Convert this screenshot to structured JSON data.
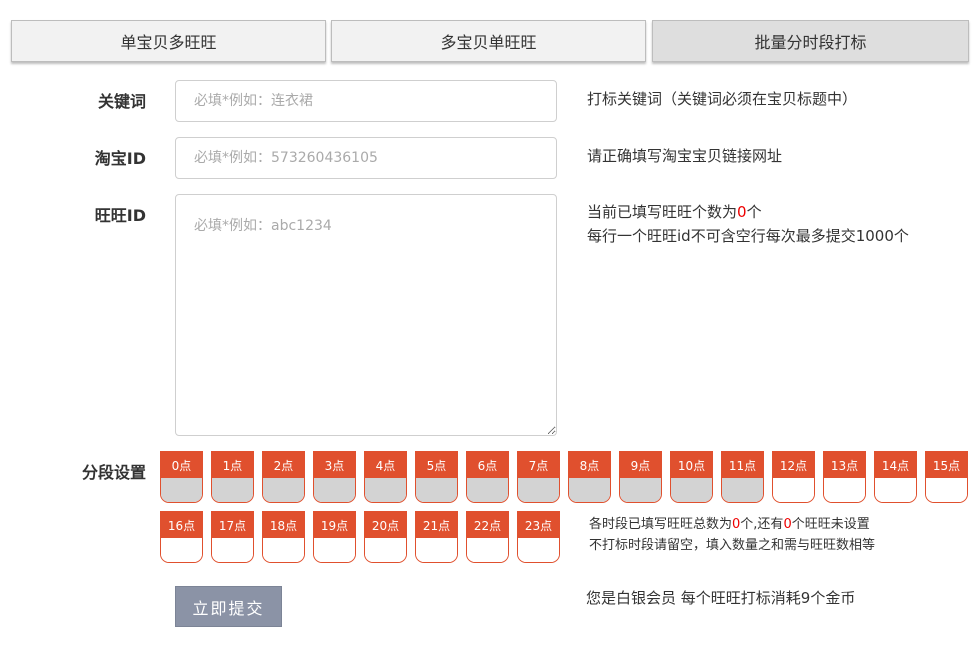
{
  "tabs": [
    {
      "label": "单宝贝多旺旺",
      "active": false
    },
    {
      "label": "多宝贝单旺旺",
      "active": false
    },
    {
      "label": "批量分时段打标",
      "active": true
    }
  ],
  "form": {
    "keyword": {
      "label": "关键词",
      "placeholder": "必填*例如：连衣裙",
      "value": "",
      "hint": "打标关键词（关键词必须在宝贝标题中）"
    },
    "taobao_id": {
      "label": "淘宝ID",
      "placeholder": "必填*例如：573260436105",
      "value": "",
      "hint": "请正确填写淘宝宝贝链接网址"
    },
    "wangwang_id": {
      "label": "旺旺ID",
      "placeholder": "必填*例如：abc1234",
      "value": "",
      "count_prefix": "当前已填写旺旺个数为",
      "count": "0",
      "count_suffix": "个",
      "hint2": "每行一个旺旺id不可含空行每次最多提交1000个"
    }
  },
  "segments": {
    "label": "分段设置",
    "hours": [
      {
        "label": "0点",
        "filled": true
      },
      {
        "label": "1点",
        "filled": true
      },
      {
        "label": "2点",
        "filled": true
      },
      {
        "label": "3点",
        "filled": true
      },
      {
        "label": "4点",
        "filled": true
      },
      {
        "label": "5点",
        "filled": true
      },
      {
        "label": "6点",
        "filled": true
      },
      {
        "label": "7点",
        "filled": true
      },
      {
        "label": "8点",
        "filled": true
      },
      {
        "label": "9点",
        "filled": true
      },
      {
        "label": "10点",
        "filled": true
      },
      {
        "label": "11点",
        "filled": true
      },
      {
        "label": "12点",
        "filled": false
      },
      {
        "label": "13点",
        "filled": false
      },
      {
        "label": "14点",
        "filled": false
      },
      {
        "label": "15点",
        "filled": false
      },
      {
        "label": "16点",
        "filled": false
      },
      {
        "label": "17点",
        "filled": false
      },
      {
        "label": "18点",
        "filled": false
      },
      {
        "label": "19点",
        "filled": false
      },
      {
        "label": "20点",
        "filled": false
      },
      {
        "label": "21点",
        "filled": false
      },
      {
        "label": "22点",
        "filled": false
      },
      {
        "label": "23点",
        "filled": false
      }
    ],
    "note1_a": "各时段已填写旺旺总数为",
    "note1_total": "0",
    "note1_b": "个,还有",
    "note1_left": "0",
    "note1_c": "个旺旺未设置",
    "note2": "不打标时段请留空，填入数量之和需与旺旺数相等"
  },
  "submit_label": "立即提交",
  "member": {
    "prefix": "您是",
    "level": "白银会员",
    "suffix": " 每个旺旺打标消耗9个金币"
  },
  "colors": {
    "accent": "#e0502e",
    "highlight": "#ee0000",
    "button": "#8b93a6"
  }
}
